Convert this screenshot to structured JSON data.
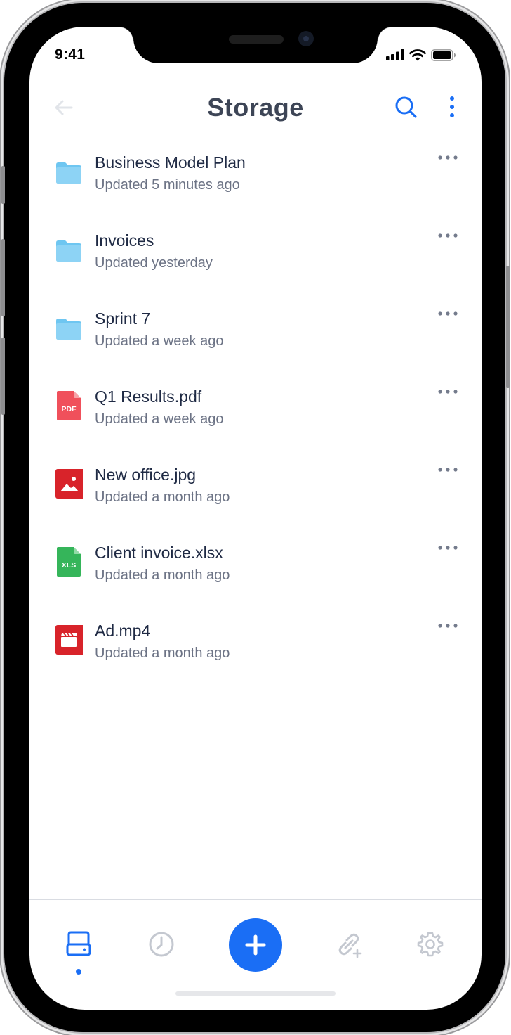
{
  "status_bar": {
    "time": "9:41",
    "icons": [
      "cellular-signal-icon",
      "wifi-icon",
      "battery-icon"
    ]
  },
  "header": {
    "title": "Storage",
    "back_icon": "arrow-left-icon",
    "search_icon": "search-icon",
    "more_icon": "vertical-dots-icon"
  },
  "files": [
    {
      "name": "Business Model Plan",
      "meta": "Updated 5 minutes ago",
      "type": "folder"
    },
    {
      "name": "Invoices",
      "meta": "Updated yesterday",
      "type": "folder"
    },
    {
      "name": "Sprint 7",
      "meta": "Updated a week ago",
      "type": "folder"
    },
    {
      "name": "Q1 Results.pdf",
      "meta": "Updated a week ago",
      "type": "pdf",
      "badge": "PDF"
    },
    {
      "name": "New office.jpg",
      "meta": "Updated a month ago",
      "type": "image"
    },
    {
      "name": "Client invoice.xlsx",
      "meta": "Updated a month ago",
      "type": "xls",
      "badge": "XLS"
    },
    {
      "name": "Ad.mp4",
      "meta": "Updated a month ago",
      "type": "video"
    }
  ],
  "tab_bar": {
    "tabs": [
      {
        "icon": "drive-icon",
        "active": true
      },
      {
        "icon": "clock-icon",
        "active": false
      },
      {
        "icon": "plus-icon",
        "active": false
      },
      {
        "icon": "add-link-icon",
        "active": false
      },
      {
        "icon": "settings-gear-icon",
        "active": false
      }
    ]
  },
  "colors": {
    "accent": "#1a6ef5",
    "title": "#3d4556",
    "file_name": "#1f2a44",
    "meta": "#6c7385",
    "folder": "#6ec6f1",
    "pdf": "#f0505b",
    "image": "#d8232a",
    "xls": "#35b55a",
    "video": "#d8232a",
    "inactive_icon": "#c4c8d0"
  }
}
